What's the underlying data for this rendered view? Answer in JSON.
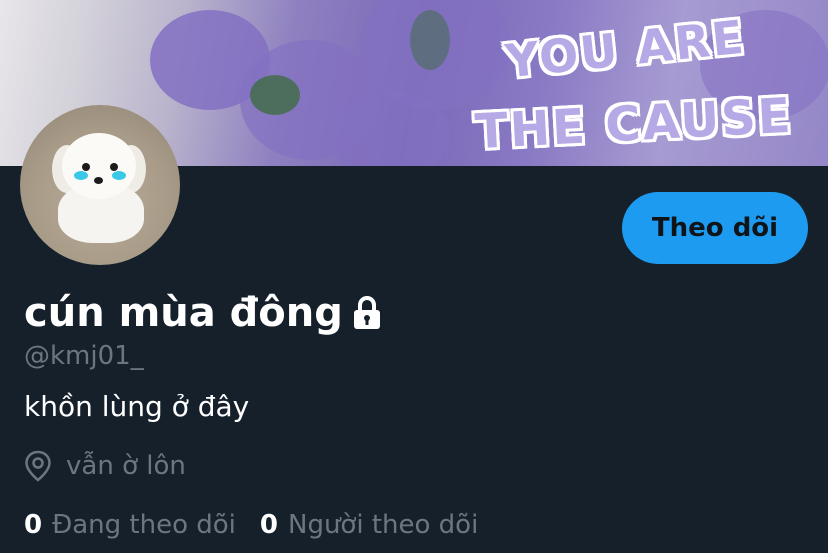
{
  "banner": {
    "sticker_line1": "YOU ARE",
    "sticker_line2": "THE CAUSE"
  },
  "profile": {
    "display_name": "cún mùa đông",
    "handle": "@kmj01_",
    "bio": "khồn lùng ở đây",
    "location": "vẫn ờ lôn",
    "protected_icon": "lock-icon"
  },
  "follow_button": {
    "label": "Theo dõi",
    "color": "#1d9bf0"
  },
  "stats": {
    "following_count": "0",
    "following_label": "Đang theo dõi",
    "followers_count": "0",
    "followers_label": "Người theo dõi"
  },
  "colors": {
    "background": "#15202b",
    "muted_text": "#6e767d",
    "accent": "#1d9bf0"
  }
}
